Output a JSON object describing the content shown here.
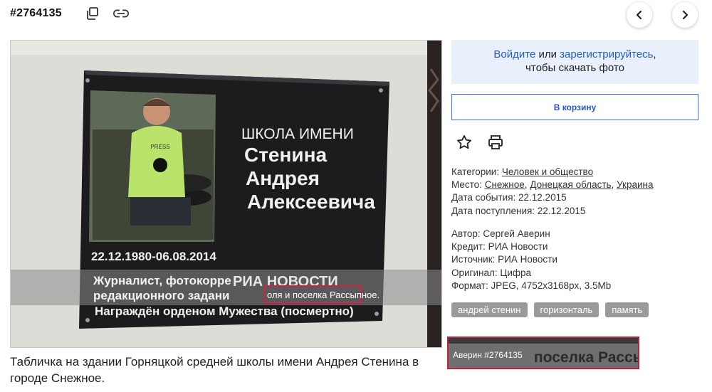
{
  "header": {
    "photo_id": "#2764135"
  },
  "icons": {
    "copy": "copy-icon",
    "link": "link-icon",
    "prev": "chevron-left-icon",
    "next": "chevron-right-icon",
    "star": "star-icon",
    "print": "printer-icon"
  },
  "photo": {
    "plaque_heading": "ШКОЛА ИМЕНИ",
    "plaque_name1": "Стенина",
    "plaque_name2": "Андрея",
    "plaque_name3": "Алексеевича",
    "plaque_dates": "22.12.1980-06.08.2014",
    "plaque_line1": "Журналист, фотокорре",
    "plaque_line2": "редакционного задани",
    "plaque_line3": "Награждён орденом Мужества (посмертно)",
    "watermark": "РИА НОВОСТИ",
    "overlay_text1": "оля и поселка Рассыпное.",
    "overlay_small": "Аверин #2764135",
    "overlay_banner": "поселка Рассыпное."
  },
  "caption": "Табличка на здании Горняцкой средней школы имени Андрея Стенина в городе Снежное.",
  "login": {
    "login_link": "Войдите",
    "or_text": " или ",
    "register_link": "зарегистрируйтесь",
    "suffix": ",",
    "line2": "чтобы скачать фото"
  },
  "cart_button": "В корзину",
  "meta": {
    "categories_label": "Категории: ",
    "category": "Человек и общество",
    "place_label": "Место: ",
    "place1": "Снежное",
    "place2": "Донецкая область",
    "place3": "Украина",
    "sep": ", ",
    "event_date": "Дата события: 22.12.2015",
    "received_date": "Дата поступления: 22.12.2015",
    "author": "Автор: Сергей Аверин",
    "credit": "Кредит: РИА Новости",
    "source": "Источник: РИА Новости",
    "original": "Оригинал: Цифра",
    "format": "Формат: JPEG, 4752x3168px, 3.5Mb"
  },
  "tags": [
    "андрей стенин",
    "горизонталь",
    "память"
  ],
  "colors": {
    "accent": "#2457c5",
    "login_bg": "#e9f0fb",
    "tag_bg": "#9a9a9a",
    "highlight_red": "#c0223a"
  }
}
